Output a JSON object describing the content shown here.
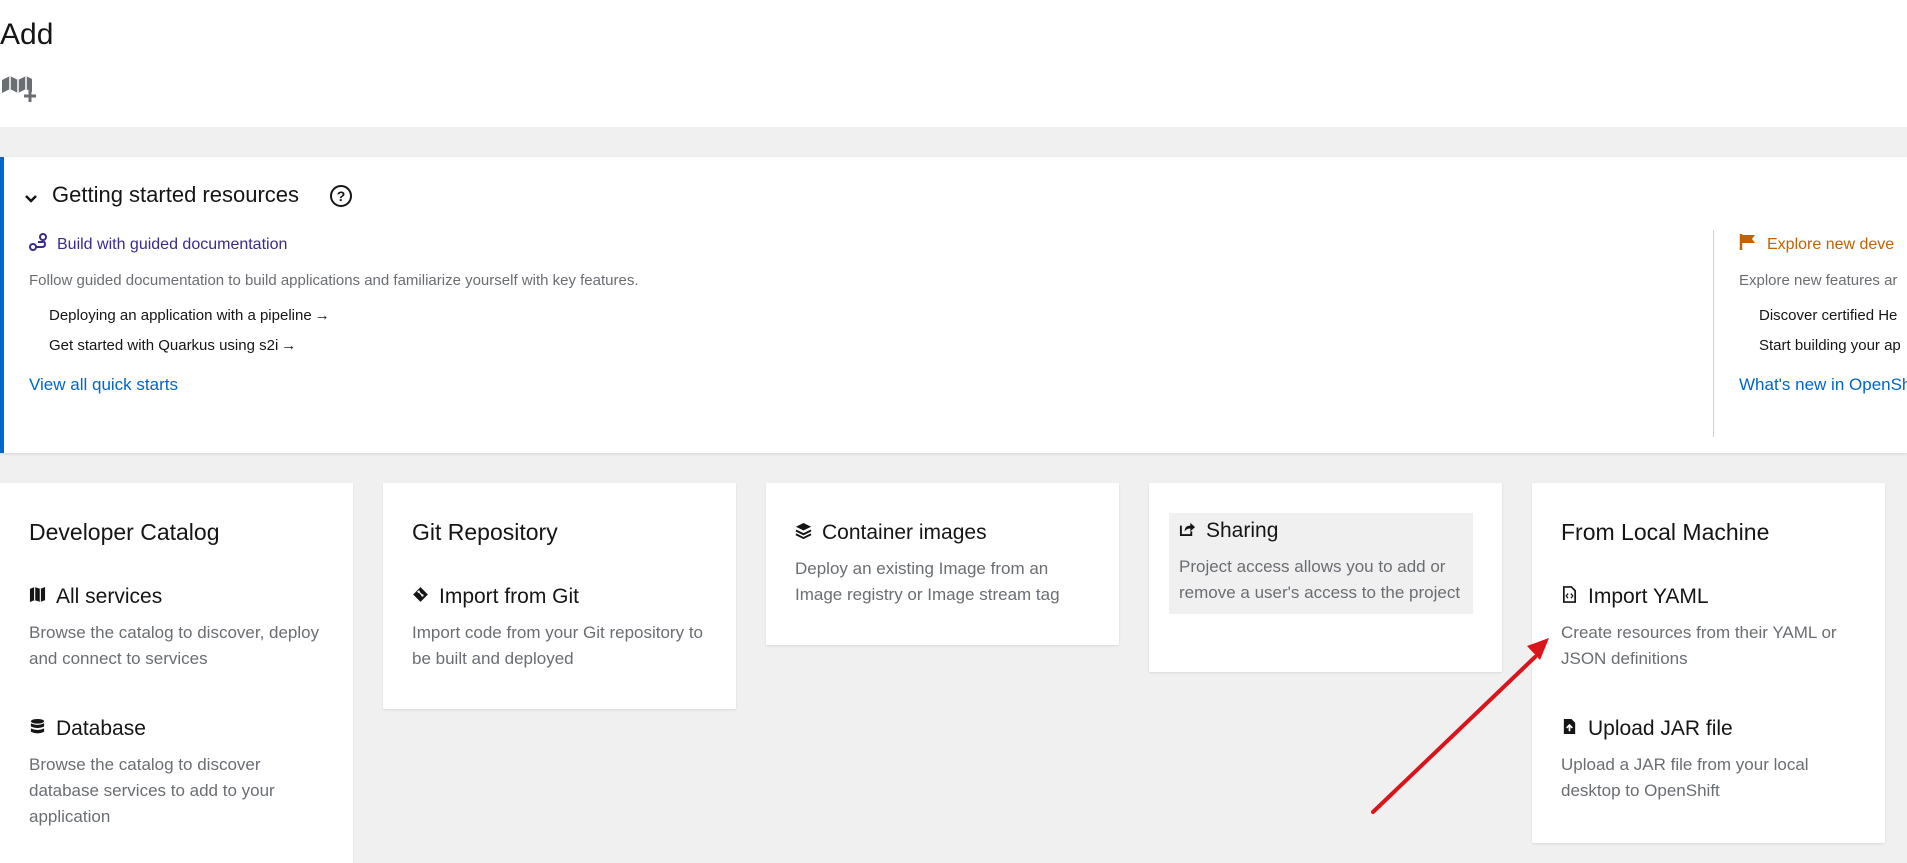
{
  "header": {
    "title": "Add",
    "icon": "book-plus-icon"
  },
  "getting_started": {
    "title": "Getting started resources",
    "columns": [
      {
        "title": "Build with guided documentation",
        "icon": "route-icon",
        "color": "#3c2a8c",
        "description": "Follow guided documentation to build applications and familiarize yourself with key features.",
        "links": [
          "Deploying an application with a pipeline",
          "Get started with Quarkus using s2i"
        ],
        "footer": "View all quick starts"
      },
      {
        "title": "Explore new deve",
        "icon": "flag-icon",
        "color": "#c46100",
        "description": "Explore new features ar",
        "links": [
          "Discover certified He",
          "Start building your ap"
        ],
        "footer": "What's new in OpenSh"
      }
    ]
  },
  "tiles": [
    {
      "title": "Developer Catalog",
      "items": [
        {
          "label": "All services",
          "icon": "book-icon",
          "description": "Browse the catalog to discover, deploy and connect to services"
        },
        {
          "label": "Database",
          "icon": "database-icon",
          "description": "Browse the catalog to discover database services to add to your application"
        }
      ]
    },
    {
      "title": "Git Repository",
      "items": [
        {
          "label": "Import from Git",
          "icon": "git-icon",
          "description": "Import code from your Git repository to be built and deployed"
        }
      ]
    },
    {
      "title": "",
      "items": [
        {
          "label": "Container images",
          "icon": "layers-icon",
          "description": "Deploy an existing Image from an Image registry or Image stream tag"
        }
      ]
    },
    {
      "title": "",
      "items": [
        {
          "label": "Sharing",
          "icon": "share-icon",
          "description": "Project access allows you to add or remove a user's access to the project"
        }
      ]
    },
    {
      "title": "From Local Machine",
      "items": [
        {
          "label": "Import YAML",
          "icon": "code-file-icon",
          "description": "Create resources from their YAML or JSON definitions"
        },
        {
          "label": "Upload JAR file",
          "icon": "file-upload-icon",
          "description": "Upload a JAR file from your local desktop to OpenShift"
        }
      ]
    }
  ],
  "colors": {
    "accent_blue": "#0066cc",
    "annotation_arrow": "#d9141b"
  }
}
